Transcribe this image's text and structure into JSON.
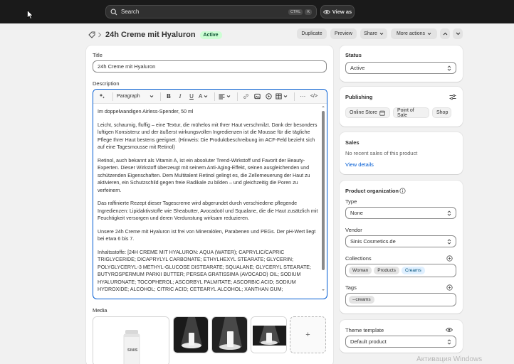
{
  "topbar": {
    "search_placeholder": "Search",
    "shortcut_ctrl": "CTRL",
    "shortcut_k": "K",
    "view_as_label": "View as"
  },
  "header": {
    "title": "24h Creme mit Hyaluron",
    "status_badge": "Active",
    "duplicate": "Duplicate",
    "preview": "Preview",
    "share": "Share",
    "more_actions": "More actions"
  },
  "main": {
    "title_label": "Title",
    "title_value": "24h Creme mit Hyaluron",
    "description_label": "Description",
    "toolbar": {
      "paragraph": "Paragraph",
      "bold": "B",
      "italic": "I",
      "underline": "U",
      "color": "A",
      "more": "···",
      "code": "</>"
    },
    "paragraphs": [
      "Im doppelwandigen Airless-Spender, 50 ml",
      "Leicht, schaumig, fluffig – eine Textur, die mühelos mit Ihrer Haut verschmilzt. Dank der besonders luftigen Konsistenz und der äußerst wirkungsvollen Ingredienzen ist die Mousse für die tägliche Pflege Ihrer Haut bestens geeignet. (Hinweis: Die Produktbeschreibung im ACF-Feld bezieht sich auf eine Tagesmousse mit Retinol)",
      "Retinol, auch bekannt als Vitamin A, ist ein absoluter Trend-Wirkstoff und Favorit der Beauty-Experten. Dieser Wirkstoff überzeugt mit seinem Anti-Aging-Effekt, seinen ausgleichenden und schützenden Eigenschaften. Dem Multitalent Retinol gelingt es, die Zellerneuerung der Haut zu aktivieren, ein Schutzschild gegen freie Radikale zu bilden – und gleichzeitig die Poren zu verfeinern.",
      "Das raffinierte Rezept dieser Tagescreme wird abgerundet durch verschiedene pflegende Ingredienzen: Lipidaktivstoffe wie Sheabutter, Avocadoöl und Squalane, die die Haut zusätzlich mit Feuchtigkeit versorgen und deren Verdunstung wirksam reduzieren.",
      "Unsere 24h Creme mit Hyaluron ist frei von Mineralölen, Parabenen und PEGs. Der pH-Wert liegt bei etwa 6 bis 7.",
      "Inhaltsstoffe: [24H CREME MIT HYALURON: AQUA (WATER); CAPRYLIC/CAPRIC TRIGLYCERIDE; DICAPRYLYL CARBONATE; ETHYLHEXYL STEARATE; GLYCERIN; POLYGLYCERYL-3 METHYL-GLUCOSE DISTEARATE; SQUALANE; GLYCERYL STEARATE; BUTYROSPERMUM PARKII BUTTER; PERSEA GRATISSIMA (AVOCADO) OIL; SODIUM HYALURONATE; TOCOPHEROL; ASCORBYL PALMITATE; ASCORBIC ACID; SODIUM HYDROXIDE; ALCOHOL; CITRIC ACID; CETEARYL ALCOHOL; XANTHAN GUM;"
    ],
    "media_label": "Media",
    "media_add": "+",
    "media_brand": "SINIS"
  },
  "sidebar": {
    "status_label": "Status",
    "status_value": "Active",
    "publishing_label": "Publishing",
    "channels": [
      "Online Store",
      "Point of Sale",
      "Shop"
    ],
    "sales_label": "Sales",
    "sales_text": "No recent sales of this product",
    "sales_link": "View details",
    "org_label": "Product organization",
    "type_label": "Type",
    "type_value": "None",
    "vendor_label": "Vendor",
    "vendor_value": "Sinis Cosmetics.de",
    "collections_label": "Collections",
    "collections": [
      "Woman",
      "Products",
      "Creams"
    ],
    "tags_label": "Tags",
    "tags": [
      "--creams"
    ],
    "template_label": "Theme template",
    "template_value": "Default product"
  },
  "watermark": "Активация Windows",
  "colors": {
    "topbar": "#1a1a1a",
    "accent": "#005bd3",
    "active_badge": "#cdfed4"
  }
}
